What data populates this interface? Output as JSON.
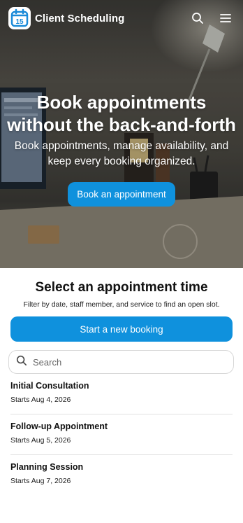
{
  "header": {
    "brand": "Client Scheduling",
    "logo_day": "15",
    "icons": [
      "calendar-icon",
      "search-icon",
      "menu-icon"
    ]
  },
  "hero": {
    "title": "Book appointments without the back-and-forth",
    "subtitle": "Book appointments, manage availability, and keep every booking organized.",
    "cta_label": "Book an appointment"
  },
  "main": {
    "title": "Select an appointment time",
    "subtitle": "Filter by date, staff member, and service to find an open slot.",
    "new_booking_label": "Start a new booking",
    "search_placeholder": "Search",
    "appointments": [
      {
        "title": "Initial Consultation",
        "date": "Starts Aug 4, 2026"
      },
      {
        "title": "Follow-up Appointment",
        "date": "Starts Aug 5, 2026"
      },
      {
        "title": "Planning Session",
        "date": "Starts Aug 7, 2026"
      }
    ]
  },
  "colors": {
    "accent": "#0f91dd",
    "logo_blue": "#1a8ad8",
    "text": "#111111",
    "divider": "#e2e2e2"
  }
}
